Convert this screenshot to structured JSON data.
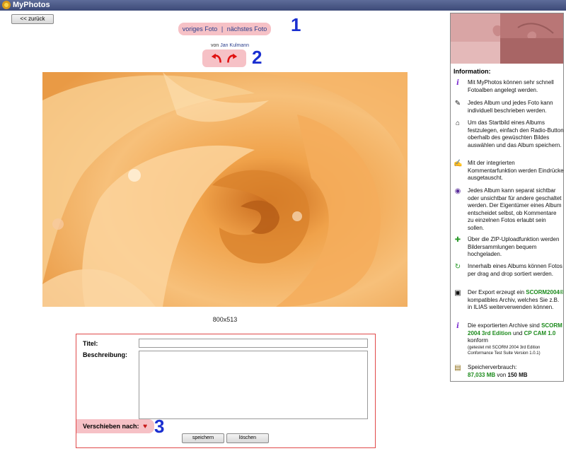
{
  "app": {
    "title": "MyPhotos"
  },
  "nav": {
    "back_label": "<< zurück",
    "prev_label": "voriges Foto",
    "separator": "|",
    "next_label": "nächstes Foto"
  },
  "markers": [
    "1",
    "2",
    "3"
  ],
  "author": {
    "prefix": "von",
    "name": "Jan Kulmann"
  },
  "photo": {
    "size_text": "800x513"
  },
  "form": {
    "title_label": "Titel:",
    "description_label": "Beschreibung:",
    "move_label": "Verschieben nach:",
    "save_label": "speichern",
    "delete_label": "löschen",
    "title_value": "",
    "description_value": ""
  },
  "info": {
    "heading": "Information:",
    "items": [
      {
        "icon": "info-icon",
        "text": "Mit MyPhotos können sehr schnell Fotoalben angelegt werden."
      },
      {
        "icon": "edit-icon",
        "text": "Jedes Album und jedes Foto kann individuell beschrieben werden."
      },
      {
        "icon": "home-icon",
        "text": "Um das Startbild eines Albums festzulegen, einfach den Radio-Button oberhalb des gewüschten Bildes auswählen und das Album speichern."
      },
      {
        "icon": "comment-icon",
        "text": "Mit der integrierten Kommentarfunktion werden Eindrücke ausgetauscht."
      },
      {
        "icon": "eye-icon",
        "text": "Jedes Album kann separat sichtbar oder unsichtbar für andere geschaltet werden. Der Eigentümer eines Album entscheidet selbst, ob Kommentare zu einzelnen Fotos erlaubt sein sollen."
      },
      {
        "icon": "zip-upload-icon",
        "text": "Über die ZIP-Uploadfunktion werden Bildersammlungen bequem hochgeladen."
      },
      {
        "icon": "refresh-icon",
        "text": "Innerhalb eines Albums können Fotos per drag and drop sortiert werden."
      },
      {
        "icon": "export-icon",
        "text_before": "Der Export erzeugt ein",
        "highlight": "SCORM2004®",
        "text_after": "kompatibles Archiv, welches Sie z.B. in ILIAS weiterverwenden können."
      },
      {
        "icon": "info-icon",
        "text_before": "Die exportierten Archive sind",
        "highlight": "SCORM 2004 3rd Edition",
        "text_mid": "und",
        "highlight2": "CP CAM 1.0",
        "text_after": "konform",
        "note": "(getestet mit SCORM 2004 3rd Edition Conformance Test Suite Version 1.0.1)"
      },
      {
        "icon": "storage-icon",
        "text_before": "Speicherverbrauch:",
        "highlight": "87,033 MB",
        "text_mid": "von",
        "bold_value": "150 MB"
      }
    ]
  },
  "colors": {
    "titlebar": "#4a5786",
    "pill_highlight": "#f6c1c6",
    "marker": "#1a2fd0",
    "form_border": "#e04a4a",
    "link": "#2a3e8c",
    "green_highlight": "#1b8a1b"
  }
}
